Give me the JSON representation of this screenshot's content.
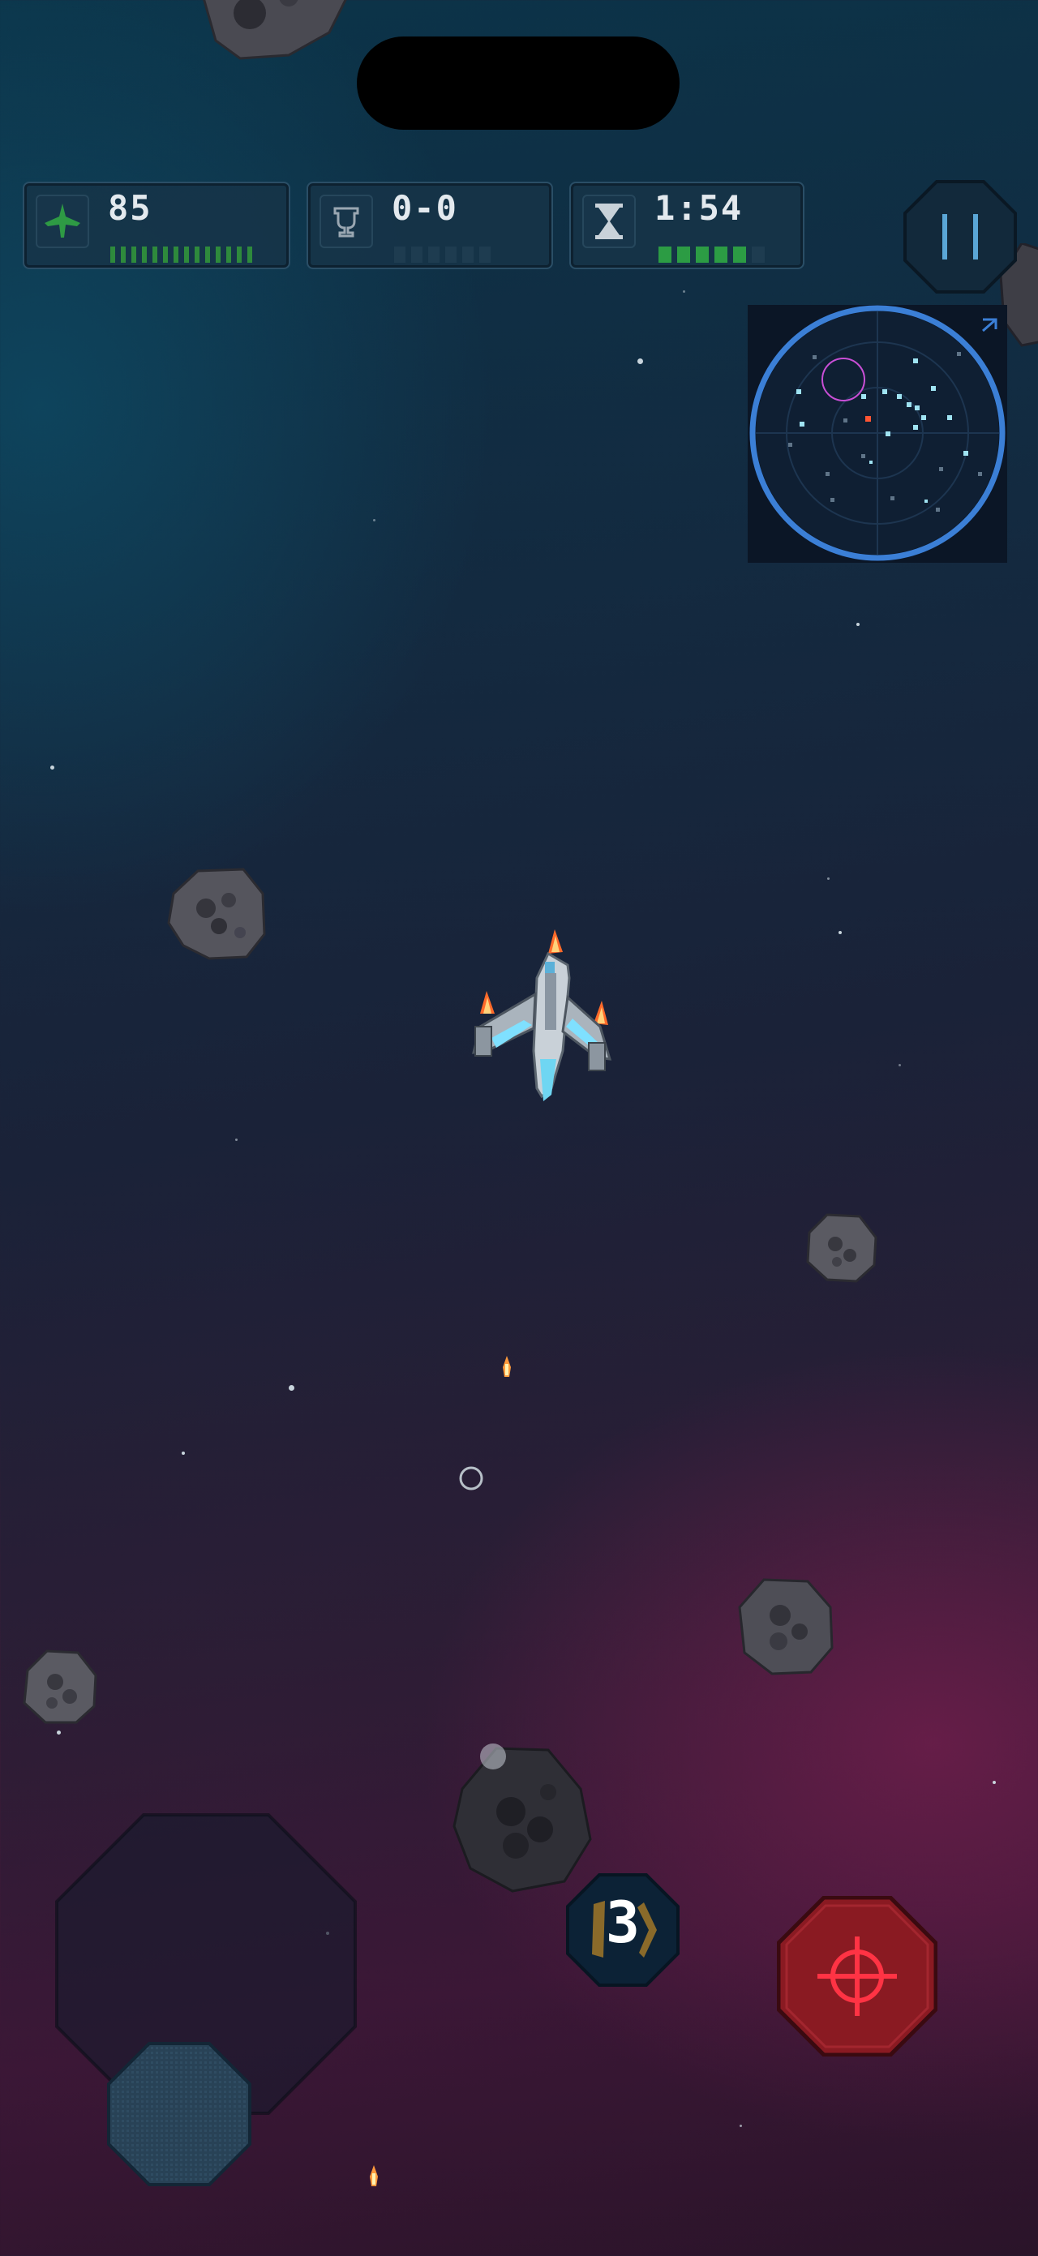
{
  "hud": {
    "health": {
      "value": "85",
      "icon": "ship-icon",
      "bar_fraction": 1.0,
      "bar_color": "#2e8a3c"
    },
    "score": {
      "value": "0-0",
      "icon": "trophy-icon",
      "bar_fraction": 0.0,
      "bar_color": "#1e3c50"
    },
    "timer": {
      "value": "1:54",
      "icon": "hourglass-icon",
      "bar_fraction": 0.83,
      "bar_color": "#2c9c44"
    }
  },
  "controls": {
    "ammo_count": "3",
    "pause_icon": "pause-icon",
    "fire_icon": "crosshair-icon"
  },
  "colors": {
    "radar_ring": "#3b7fd6",
    "fire_button": "#8a1a22",
    "enemy_blip": "#ff5533",
    "ally_blip": "#9fe3f2"
  }
}
